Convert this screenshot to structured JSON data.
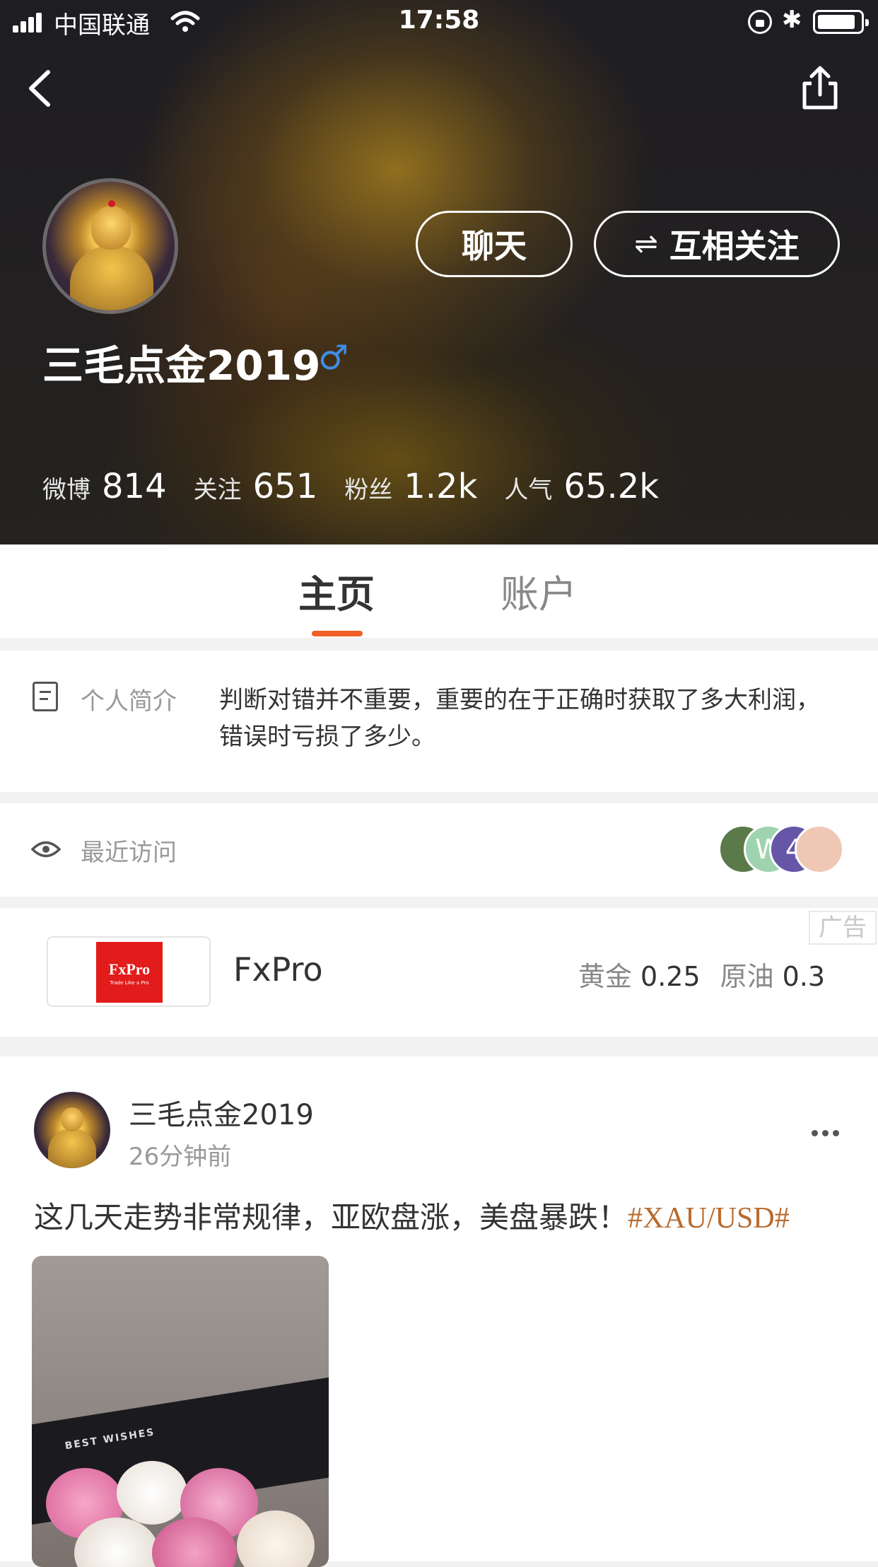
{
  "status_bar": {
    "carrier": "中国联通",
    "time": "17:58",
    "bluetooth": "✱"
  },
  "nav": {
    "back_icon": "chevron-left-icon",
    "share_icon": "share-icon"
  },
  "profile": {
    "name": "三毛点金2019",
    "gender_symbol": "♂",
    "chat_button": "聊天",
    "follow_button": "互相关注",
    "follow_icon": "⇌",
    "stats": [
      {
        "label": "微博",
        "value": "814"
      },
      {
        "label": "关注",
        "value": "651"
      },
      {
        "label": "粉丝",
        "value": "1.2k"
      },
      {
        "label": "人气",
        "value": "65.2k"
      }
    ]
  },
  "tabs": {
    "home": "主页",
    "account": "账户"
  },
  "bio": {
    "label": "个人简介",
    "text": "判断对错并不重要，重要的在于正确时获取了多大利润，错误时亏损了多少。"
  },
  "recent_visits": {
    "label": "最近访问",
    "visitors": [
      {
        "letter": "",
        "color": "#5b7a4a"
      },
      {
        "letter": "W",
        "color": "#9fd3b0"
      },
      {
        "letter": "4",
        "color": "#6656a8"
      },
      {
        "letter": "",
        "color": "#efc7b5"
      }
    ]
  },
  "ad": {
    "tag": "广告",
    "logo_text": "FxPro",
    "logo_slogan": "Trade Like a Pro",
    "name": "FxPro",
    "quotes": [
      {
        "label": "黄金",
        "value": "0.25"
      },
      {
        "label": "原油",
        "value": "0.3"
      }
    ]
  },
  "post": {
    "author": "三毛点金2019",
    "time": "26分钟前",
    "text": "这几天走势非常规律，亚欧盘涨，美盘暴跌！",
    "hashtag": "#XAU/USD#",
    "image_caption": "BEST WISHES"
  },
  "colors": {
    "accent": "#f15f26",
    "gender": "#3f8ee6",
    "hashtag": "#b86a2c",
    "ad_logo": "#e21b1b"
  }
}
